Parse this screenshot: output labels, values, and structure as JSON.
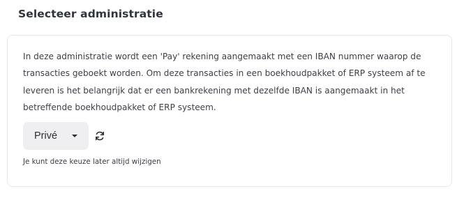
{
  "header": {
    "title": "Selecteer administratie"
  },
  "card": {
    "description": "In deze administratie wordt een 'Pay' rekening aangemaakt met een IBAN nummer waarop de transacties geboekt worden. Om deze transacties in een boekhoudpakket of ERP systeem af te leveren is het belangrijk dat er een bankrekening met dezelfde IBAN is aangemaakt in het betreffende boekhoudpakket of ERP systeem.",
    "select": {
      "selected": "Privé",
      "icon": "caret-down-icon"
    },
    "refresh_icon": "refresh-icon",
    "hint": "Je kunt deze keuze later altijd wijzigen"
  },
  "colors": {
    "text": "#2b2f36",
    "card_border": "#e7e8eb",
    "select_background": "#efeff1"
  }
}
